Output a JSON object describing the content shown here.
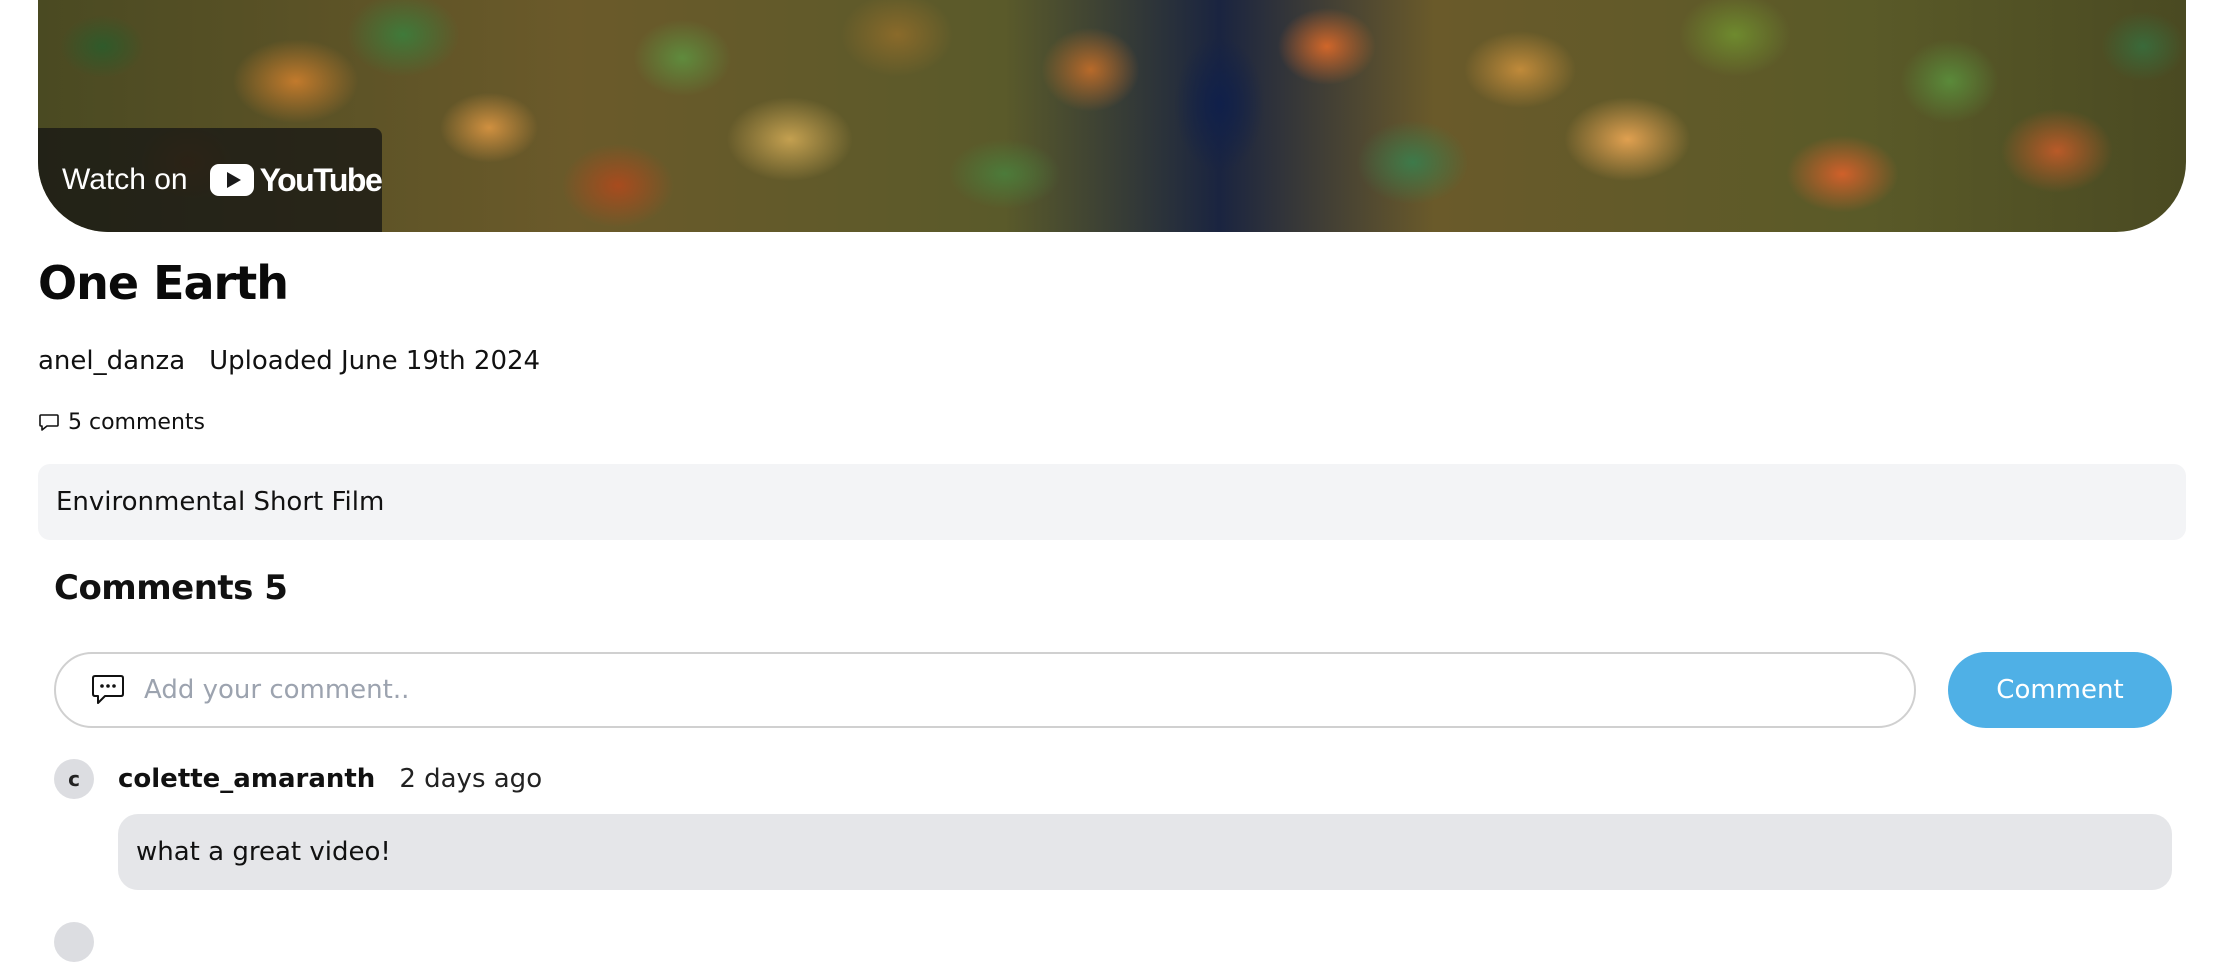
{
  "video": {
    "watch_label": "Watch on",
    "youtube_label": "YouTube"
  },
  "post": {
    "title": "One Earth",
    "author": "anel_danza",
    "uploaded": "Uploaded June 19th 2024",
    "comments_count_label": "5 comments",
    "description": "Environmental Short Film"
  },
  "comments": {
    "heading": "Comments 5",
    "input_placeholder": "Add your comment..",
    "submit_label": "Comment",
    "items": [
      {
        "avatar_letter": "c",
        "username": "colette_amaranth",
        "time": "2 days ago",
        "text": "what a great video!"
      }
    ]
  },
  "colors": {
    "comment_button": "#4fb0e6",
    "description_bg": "#f3f4f6",
    "comment_bg": "#e5e6e9"
  },
  "icons": {
    "comment_count": "speech-bubble-icon",
    "comment_input": "chat-dots-icon",
    "youtube": "youtube-play-icon"
  }
}
